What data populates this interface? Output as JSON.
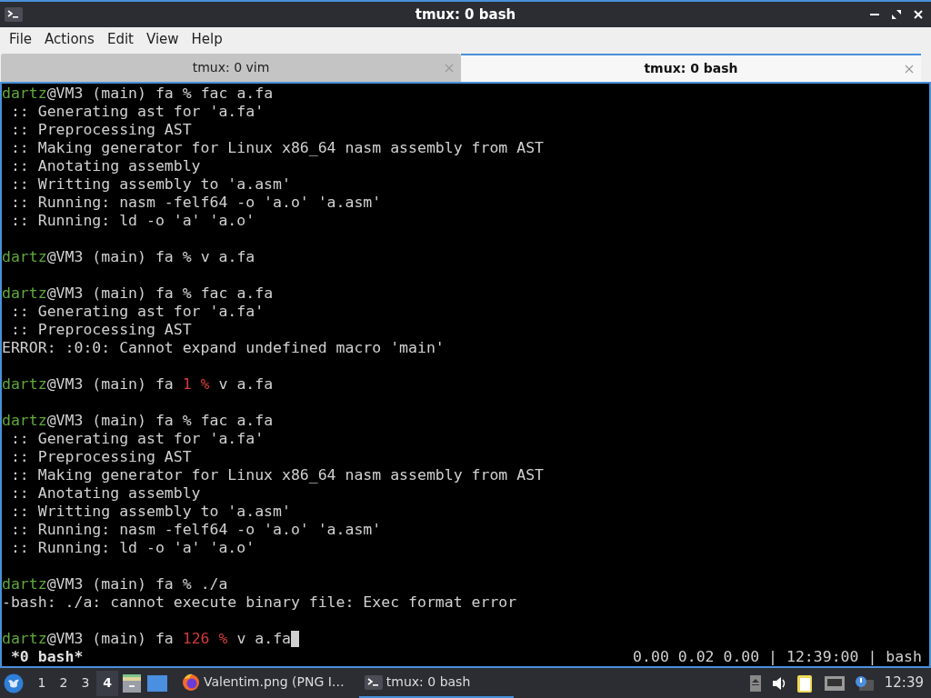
{
  "window": {
    "title": "tmux: 0 bash"
  },
  "menu": [
    "File",
    "Actions",
    "Edit",
    "View",
    "Help"
  ],
  "tabs": [
    {
      "label": "tmux: 0 vim",
      "selected": false
    },
    {
      "label": "tmux: 0 bash",
      "selected": true
    }
  ],
  "terminal": {
    "lines": [
      {
        "kind": "prompt",
        "user": "dartz",
        "host": "@VM3 (main) fa",
        "status": "%",
        "error": false,
        "command": "fac a.fa",
        "cursor": false
      },
      {
        "kind": "output",
        "text": " :: Generating ast for 'a.fa'"
      },
      {
        "kind": "output",
        "text": " :: Preprocessing AST"
      },
      {
        "kind": "output",
        "text": " :: Making generator for Linux x86_64 nasm assembly from AST"
      },
      {
        "kind": "output",
        "text": " :: Anotating assembly"
      },
      {
        "kind": "output",
        "text": " :: Writting assembly to 'a.asm'"
      },
      {
        "kind": "output",
        "text": " :: Running: nasm -felf64 -o 'a.o' 'a.asm'"
      },
      {
        "kind": "output",
        "text": " :: Running: ld -o 'a' 'a.o'"
      },
      {
        "kind": "blank"
      },
      {
        "kind": "prompt",
        "user": "dartz",
        "host": "@VM3 (main) fa",
        "status": "%",
        "error": false,
        "command": "v a.fa",
        "cursor": false
      },
      {
        "kind": "blank"
      },
      {
        "kind": "prompt",
        "user": "dartz",
        "host": "@VM3 (main) fa",
        "status": "%",
        "error": false,
        "command": "fac a.fa",
        "cursor": false
      },
      {
        "kind": "output",
        "text": " :: Generating ast for 'a.fa'"
      },
      {
        "kind": "output",
        "text": " :: Preprocessing AST"
      },
      {
        "kind": "output",
        "text": "ERROR: :0:0: Cannot expand undefined macro 'main'"
      },
      {
        "kind": "blank"
      },
      {
        "kind": "prompt",
        "user": "dartz",
        "host": "@VM3 (main) fa",
        "status": "1 %",
        "error": true,
        "command": "v a.fa",
        "cursor": false
      },
      {
        "kind": "blank"
      },
      {
        "kind": "prompt",
        "user": "dartz",
        "host": "@VM3 (main) fa",
        "status": "%",
        "error": false,
        "command": "fac a.fa",
        "cursor": false
      },
      {
        "kind": "output",
        "text": " :: Generating ast for 'a.fa'"
      },
      {
        "kind": "output",
        "text": " :: Preprocessing AST"
      },
      {
        "kind": "output",
        "text": " :: Making generator for Linux x86_64 nasm assembly from AST"
      },
      {
        "kind": "output",
        "text": " :: Anotating assembly"
      },
      {
        "kind": "output",
        "text": " :: Writting assembly to 'a.asm'"
      },
      {
        "kind": "output",
        "text": " :: Running: nasm -felf64 -o 'a.o' 'a.asm'"
      },
      {
        "kind": "output",
        "text": " :: Running: ld -o 'a' 'a.o'"
      },
      {
        "kind": "blank"
      },
      {
        "kind": "prompt",
        "user": "dartz",
        "host": "@VM3 (main) fa",
        "status": "%",
        "error": false,
        "command": "./a",
        "cursor": false
      },
      {
        "kind": "output",
        "text": "-bash: ./a: cannot execute binary file: Exec format error"
      },
      {
        "kind": "blank"
      },
      {
        "kind": "prompt",
        "user": "dartz",
        "host": "@VM3 (main) fa",
        "status": "126 %",
        "error": true,
        "command": "v a.fa",
        "cursor": true
      }
    ]
  },
  "tmux_status": {
    "window": " *0 bash*",
    "right": "0.00 0.02 0.00 | 12:39:00 | bash"
  },
  "taskbar": {
    "workspaces": [
      {
        "label": "1",
        "selected": false
      },
      {
        "label": "2",
        "selected": false
      },
      {
        "label": "3",
        "selected": false
      },
      {
        "label": "4",
        "selected": true
      }
    ],
    "tasks": [
      {
        "kind": "firefox",
        "label": "Valentim.png (PNG I…",
        "selected": false
      },
      {
        "kind": "terminal",
        "label": "tmux: 0 bash",
        "selected": true
      }
    ],
    "clock": "12:39"
  }
}
